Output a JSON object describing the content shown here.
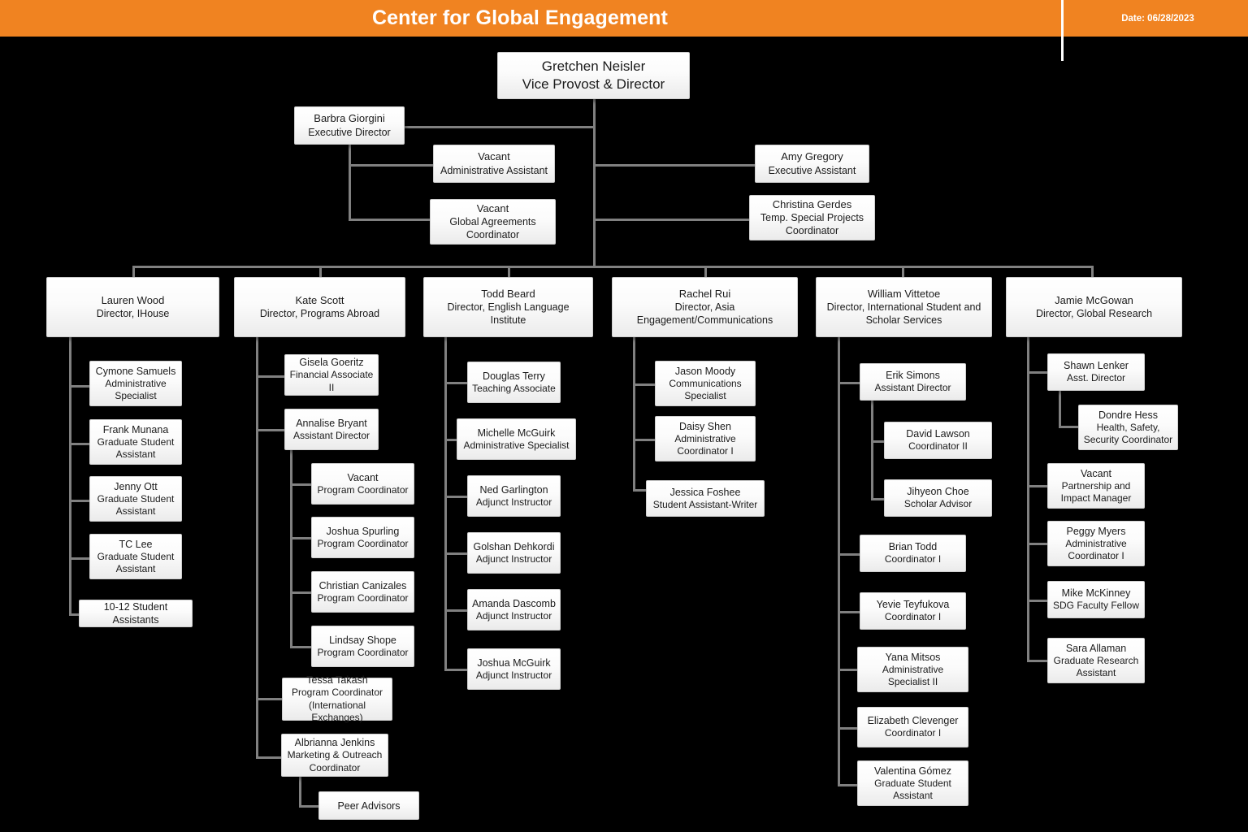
{
  "header": {
    "title": "Center for Global Engagement",
    "date_label": "Date: 06/28/2023",
    "accent_color": "#F08321",
    "text_color": "#FFFFFF"
  },
  "theme": {
    "background": "#000000",
    "connector_color": "#808080",
    "box_border": "#CFCFCF",
    "box_text": "#1B1B1B"
  },
  "chart_type": "organization-chart",
  "nodes": {
    "root": {
      "name": "Gretchen Neisler",
      "title": "Vice Provost & Director"
    },
    "exec_director": {
      "name": "Barbra Giorgini",
      "title": "Executive Director"
    },
    "admin_assistant": {
      "name": "Vacant",
      "title": "Administrative Assistant"
    },
    "global_agreements": {
      "name": "Vacant",
      "title": "Global Agreements Coordinator"
    },
    "exec_assistant": {
      "name": "Amy Gregory",
      "title": "Executive Assistant"
    },
    "special_projects": {
      "name": "Christina Gerdes",
      "title": "Temp. Special Projects Coordinator"
    },
    "dir_ihouse": {
      "name": "Lauren Wood",
      "title": "Director, IHouse"
    },
    "dir_programs_abroad": {
      "name": "Kate Scott",
      "title": "Director, Programs Abroad"
    },
    "dir_eli": {
      "name": "Todd Beard",
      "title": "Director, English Language Institute"
    },
    "dir_asia": {
      "name": "Rachel Rui",
      "title": "Director, Asia Engagement/Communications"
    },
    "dir_isss": {
      "name": "William Vittetoe",
      "title": "Director, International Student and Scholar Services"
    },
    "dir_global_research": {
      "name": "Jamie McGowan",
      "title": "Director, Global Research"
    },
    "ihouse": [
      {
        "name": "Cymone Samuels",
        "title": "Administrative Specialist"
      },
      {
        "name": "Frank Munana",
        "title": "Graduate Student Assistant"
      },
      {
        "name": "Jenny Ott",
        "title": "Graduate Student Assistant"
      },
      {
        "name": "TC Lee",
        "title": "Graduate Student Assistant"
      },
      {
        "name": "10-12 Student Assistants",
        "title": ""
      }
    ],
    "programs_abroad": [
      {
        "name": "Gisela Goeritz",
        "title": "Financial Associate II"
      },
      {
        "name": "Annalise Bryant",
        "title": "Assistant Director"
      },
      {
        "name": "Tessa Takash",
        "title": "Program Coordinator (International Exchanges)"
      },
      {
        "name": "Albrianna Jenkins",
        "title": "Marketing & Outreach Coordinator"
      }
    ],
    "annalise_reports": [
      {
        "name": "Vacant",
        "title": "Program Coordinator"
      },
      {
        "name": "Joshua Spurling",
        "title": "Program Coordinator"
      },
      {
        "name": "Christian Canizales",
        "title": "Program Coordinator"
      },
      {
        "name": "Lindsay Shope",
        "title": "Program Coordinator"
      }
    ],
    "albrianna_reports": [
      {
        "name": "Peer Advisors",
        "title": ""
      }
    ],
    "eli": [
      {
        "name": "Douglas Terry",
        "title": "Teaching Associate"
      },
      {
        "name": "Michelle McGuirk",
        "title": "Administrative Specialist"
      },
      {
        "name": "Ned Garlington",
        "title": "Adjunct Instructor"
      },
      {
        "name": "Golshan Dehkordi",
        "title": "Adjunct Instructor"
      },
      {
        "name": "Amanda Dascomb",
        "title": "Adjunct Instructor"
      },
      {
        "name": "Joshua McGuirk",
        "title": "Adjunct Instructor"
      }
    ],
    "asia": [
      {
        "name": "Jason Moody",
        "title": "Communications Specialist"
      },
      {
        "name": "Daisy Shen",
        "title": "Administrative Coordinator I"
      },
      {
        "name": "Jessica Foshee",
        "title": "Student Assistant-Writer"
      }
    ],
    "isss": [
      {
        "name": "Erik Simons",
        "title": "Assistant Director"
      },
      {
        "name": "Brian Todd",
        "title": "Coordinator I"
      },
      {
        "name": "Yevie Teyfukova",
        "title": "Coordinator I"
      },
      {
        "name": "Yana Mitsos",
        "title": "Administrative Specialist II"
      },
      {
        "name": "Elizabeth Clevenger",
        "title": "Coordinator I"
      },
      {
        "name": "Valentina Gómez",
        "title": "Graduate Student Assistant"
      }
    ],
    "erik_reports": [
      {
        "name": "David Lawson",
        "title": "Coordinator II"
      },
      {
        "name": "Jihyeon Choe",
        "title": "Scholar Advisor"
      }
    ],
    "global_research": [
      {
        "name": "Shawn Lenker",
        "title": "Asst. Director"
      },
      {
        "name": "Vacant",
        "title": "Partnership and Impact Manager"
      },
      {
        "name": "Peggy Myers",
        "title": "Administrative Coordinator I"
      },
      {
        "name": "Mike McKinney",
        "title": "SDG Faculty Fellow"
      },
      {
        "name": "Sara Allaman",
        "title": "Graduate Research Assistant"
      }
    ],
    "shawn_reports": [
      {
        "name": "Dondre Hess",
        "title": "Health, Safety, Security Coordinator"
      }
    ]
  }
}
